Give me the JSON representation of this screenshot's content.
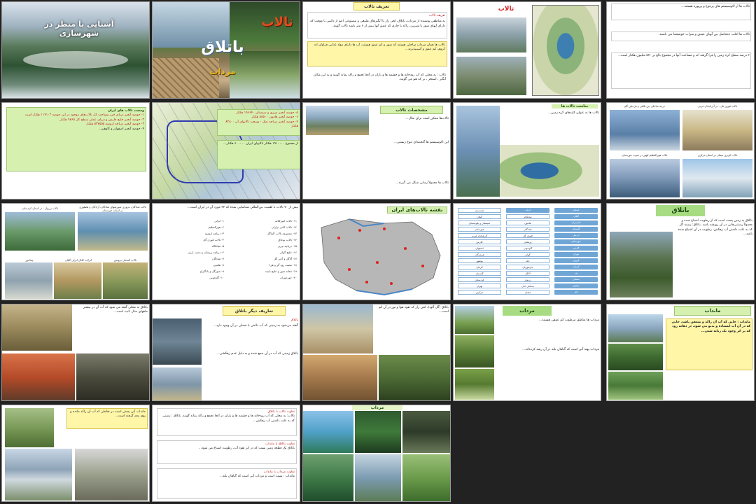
{
  "slides": {
    "s1": {
      "title": "آشنایی با منظر در شهرسازی"
    },
    "s2": {
      "brand1": "تالاب",
      "brand2": "باتلاق",
      "brand3": "مرداب"
    },
    "s3": {
      "title": "تعریف تالاب",
      "p1": "تعریف تالاب",
      "p2": "به مناطقی پوشیده از مرداب، باتلاق، لجن زار یا آبگیرهای طبیعی و مصنوعی اعم از دائمی یا موقت که دارای آبهای شور یا شیرین، راکد یا جاری که عمق آنها بیش از ۶ متر باشد تالاب گویند.",
      "p3": "تالاب ها همان مرداب ساحلی هستند که شور و کم عمق هستند، آب ها دارای مواد غذایی فراوان اند کروم، کم عمق و آسیبپذیرند...",
      "p4": "تالاب : به محلی که آب رودخانه ها و چشمه ها و باران در آنجا تجمع و راکد بماند گویند و به این مکان آبگیر ، استخر ، بر که هم می گویند."
    },
    "s4": {
      "title": "تالاب"
    },
    "s5": {
      "p1": "تالاب ها از اکوسیستم های پرتنوع و پربهره هستند...",
      "p2": "تالاب ها اغلب حدفاصل بین آبهای عمیق و سراب خوشجما می باشند.",
      "p3": "۶ درصد سطح کره زمین را فرا گرفته اند و مساحت آنها در مجموع بالغ بر ۵۷۰ میلیون هکتار است..."
    },
    "s6": {
      "title": "وسعت تالاب های ایران",
      "lines": [
        "۱- حوضه آبخیز دریای خزر مساحت کل تالاب‌های موجود در این حوضه ۱۱۷۱۰۲ هکتار است",
        "۲- حوضه آبخیز خلیج فارس و دریای عمان سطح کل ۹۸۶۵ هکتار",
        "۳- حوضه آبخیز دریاچه ارومیه ۵۳۷۵۵۵ هکتار",
        "۴- حوضه آبخیز اصفهان و کاوهیر..."
      ]
    },
    "s8": {
      "lines": [
        "۵- حوضه آبخیز مرزی و سیستان ۱۹۶۶۴۰ هکتار",
        "۶- حوضه آبخیز هامون ۸۵۵۰۰ هکتار",
        "۷- حوضه آبخیز دریاچه نمک - وسعت تالابهای آن ۸۲۸۰۰ هکتار"
      ],
      "p": "از مجموع ۱۹۱۰۰۰۰ هکتار تالابهای ایران ۶۰۰۰۰۰ هکتار..."
    },
    "s9": {
      "title": "مشخصات تالاب",
      "p1": "تالاب‌ها ممکن است برای مثال...",
      "p2": "این اکوسیستم ها گنجینه‌ای تنوع زیستی...",
      "p3": "تالاب ها معمولاً زمانی شکل می گیرند..."
    },
    "s10": {
      "title": "مناسب تالاب ها",
      "p": "تالاب ها به عنوان کلیه‌های کره زمین..."
    },
    "s11": {
      "cap1": "درچه ساحلی بین تلاقی و فرحیلن گاو",
      "cap2": "تالاب قوری قل - در آذربایجان غربی",
      "cap3": "تالاب هورالعظیم کهور در جنوب خوزستان",
      "cap4": "تالاب کویری میقان در استان مرکزی"
    },
    "s12": {
      "cap1": "تالاب شادگان، مروری شورشهای شادگان، آزادگان و فصلوری در استان خوزستان",
      "cap2": "تالاب زریوار - در استان کردستان",
      "cap3": "چغاخور",
      "cap4": "انزلاب کانال انزلی گیلان",
      "cap5": "تالاب گندمان برونش"
    },
    "s13": {
      "p": "بیش از ۷۰ تالاب با اهمیت بین‌المللی شناسایی شده که ۲۴ مورد آن در ایران است...",
      "col1": [
        "۱- انزلی",
        "۲- هورالعظیم",
        "۳- دریاچه ارومیه",
        "۴- تالاب قوری گل",
        "۵- میانکاله",
        "۶- دریاچه پریشان و دشت ارژن",
        "۷- شادگان",
        "۸- هامون",
        "۹- شورگل و یادگارلو",
        "۱۰- گاوخونی"
      ],
      "col2": [
        "۱۱- تالاب امیرکلایه",
        "۱۲- تالاب کانی برازان",
        "۱۳- مجموعه تالاب آلماگل",
        "۱۴- تالاب بوجاق",
        "۱۵- دریاچه نیریز",
        "۱۶- خلیج گواتر",
        "۱۷- آلاگل و آجی گل",
        "۱۸- مصب رود گز و هرا",
        "۱۹- دهانه شور و خلیج نایبند",
        "۲۰- خورخوران"
      ]
    },
    "s14": {
      "title": "نقشه تالاب‌های ایران"
    },
    "s15": {
      "col1": [
        "مازندران",
        "گیلان",
        "سیستان و بلوچستان",
        "خوزستان",
        "آذربایجان غربی",
        "فارس",
        "اصفهان",
        "هرمزگان",
        "بوشهر",
        "کرمان",
        "گلستان",
        "کردستان",
        "تهران",
        "مرکزی",
        "قم"
      ],
      "col2": [
        "انزلی",
        "میانکاله",
        "هامون",
        "شادگان",
        "قوری گل",
        "پریشان",
        "گاوخونی",
        "گواتر",
        "حله",
        "جازموریان",
        "آلاگل",
        "زریوار",
        "بندعلی خان",
        "میقان",
        "حوض سلطان"
      ],
      "col3": [
        "استان",
        "گیلان",
        "مازندران",
        "گلستان",
        "اردبیل",
        "خوزستان",
        "فارس",
        "تهران",
        "قزوین",
        "کرمان",
        "یزد",
        "سمنان",
        "بوشهر",
        "قم",
        "ایلام"
      ]
    },
    "s16": {
      "title": "باتلاق",
      "p": "باتلاق به زمین پست است که از رطوبت اشباع شده و معمولاً رستنی‌هایی در آن رویشه باشد. باتلاق: زمینه گل که به علت داشتن آب زهکش، رطوبت در آن اشباع شده باشد..."
    },
    "s17": {
      "p": "باتلاق به محلی گفته می شود که آب آن در بیشتر ماههای سال ثابت است..."
    },
    "s18": {
      "title": "تعاریف دیگر باتلاق",
      "p1": "باتلاق",
      "p2": "گفته می‌شود به زمینی که آب دائمی یا فصلی در آن وجود دارد...",
      "p3": "باتلاق زمینی که آب در آن جمع شده و به دلیل عدم زهکشی..."
    },
    "s19": {
      "p": "باتلاق (گل آلود)، لجن زار که نفوذ هوا و نور در آن کم است..."
    },
    "s20": {
      "title": "مرداب",
      "p1": "مرداب ها مناطق مرطوب کم عمقی هستند...",
      "p2": "مرداب پهنه آبی است که گیاهان بلند در آن رشد کرده‌اند..."
    },
    "s21": {
      "title": "مانداب",
      "p": "مانداب : جایی که آب آن راکد و متعفن باشد. جایی که در آن آب ایستاده و بدبو می شود. در دهانه رود که بر اثر وجود یک زبانه شنی..."
    },
    "s22": {
      "p": "مانداب آبی پستی است در نقاطی که آب آن راکد مانده و بوی بدی گرفته است..."
    },
    "s23": {
      "h1": "تفاوت تالاب با باتلاق",
      "p1": "تالاب: به محلی که آب رودخانه ها و چشمه ها و باران در آنجا تجمع و راکد بماند گویند. باتلاق : زمینی که به علت داشتن آب زهکش...",
      "h2": "تفاوت باتلاق با مانداب",
      "p2": "باتلاق یک قطعه زمین پست که در اثر نفوذ آب، رطوبت اشباع می شود...",
      "h3": "تفاوت مرداب با مانداب",
      "p3": "مانداب : پست است و مرداب آبی است که گیاهان بلند..."
    },
    "s24": {
      "title": "مرداب"
    }
  }
}
